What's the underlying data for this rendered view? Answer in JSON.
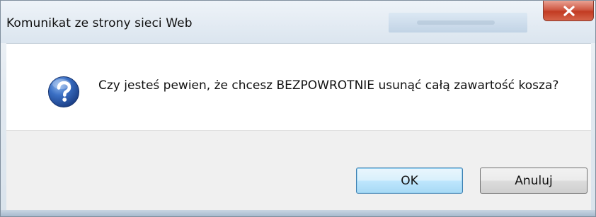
{
  "dialog": {
    "title": "Komunikat ze strony sieci Web",
    "close_icon": "close-x-icon",
    "message_icon": "question-icon",
    "message": "Czy jesteś pewien, że chcesz BEZPOWROTNIE usunąć całą zawartość kosza?",
    "buttons": {
      "ok_label": "OK",
      "cancel_label": "Anuluj"
    }
  },
  "colors": {
    "close_button": "#c23b22",
    "ok_button_border": "#3c7fb1",
    "question_icon": "#2a5caa"
  }
}
